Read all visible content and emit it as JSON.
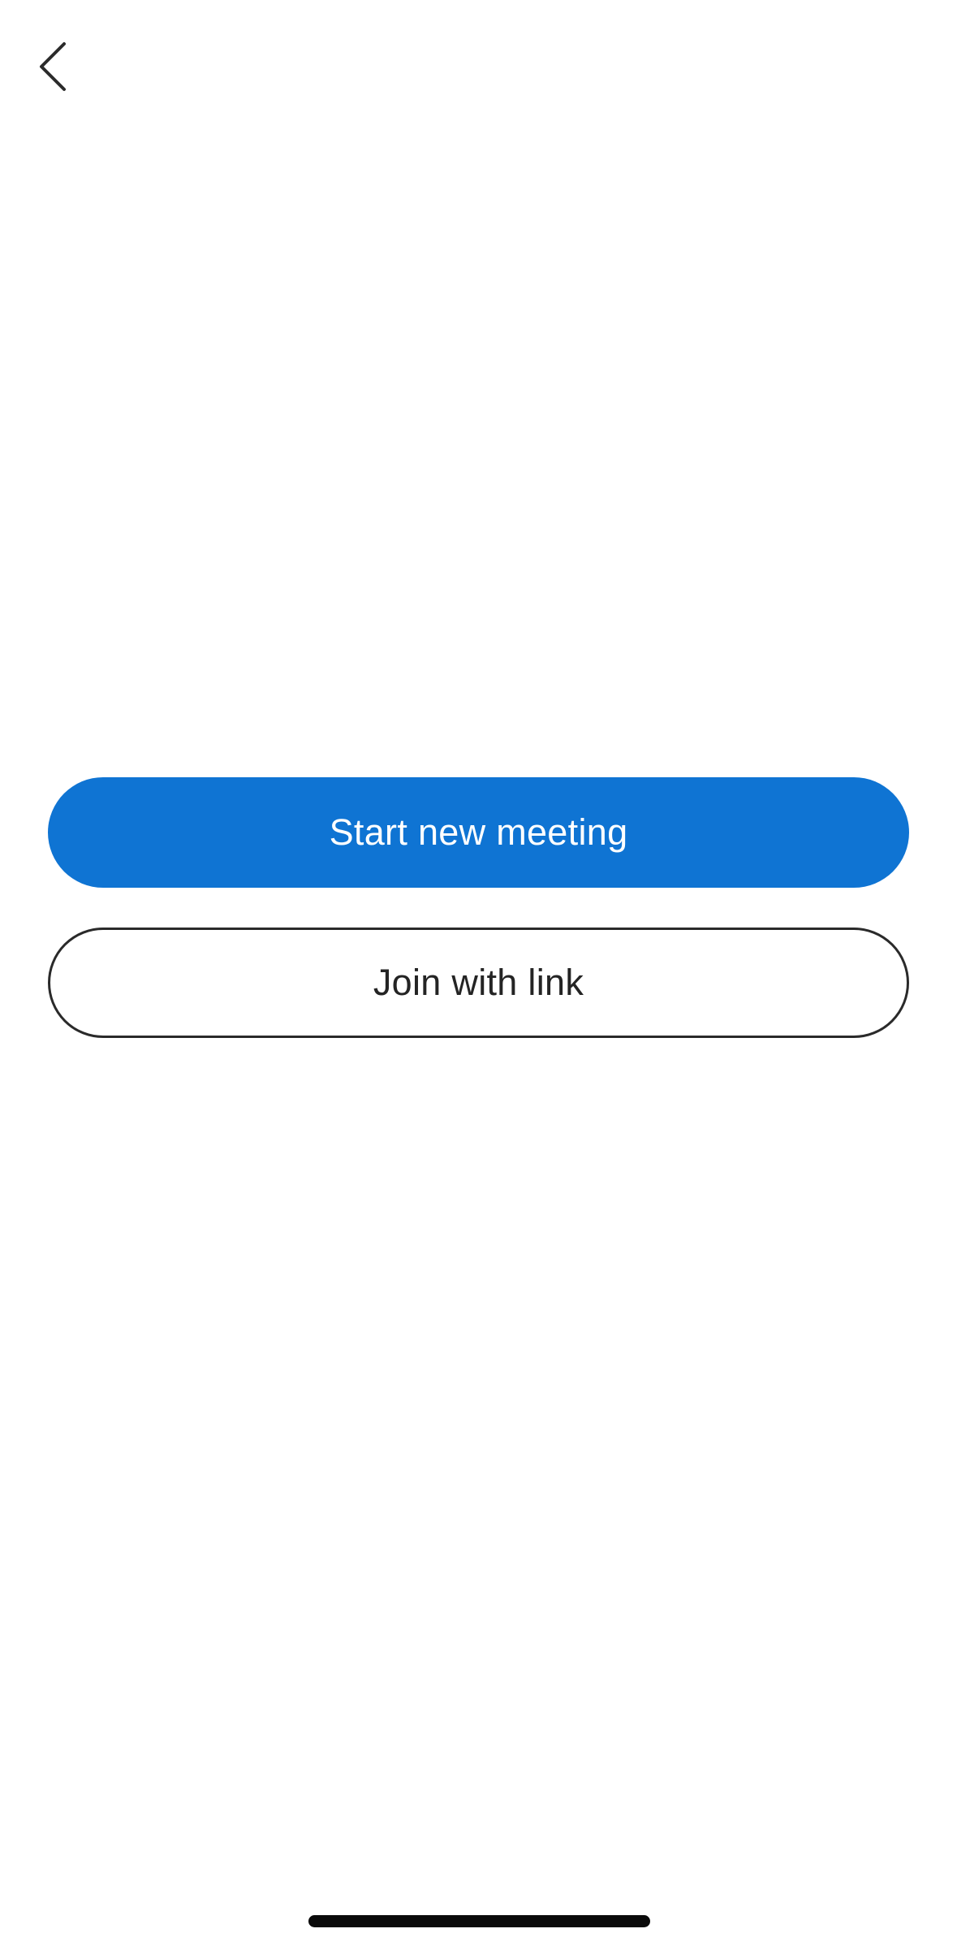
{
  "header": {
    "back_icon": "chevron-left-icon"
  },
  "actions": {
    "start_meeting_label": "Start new meeting",
    "join_link_label": "Join with link"
  },
  "colors": {
    "primary": "#0f74d3",
    "text_dark": "#242424",
    "background": "#ffffff"
  }
}
